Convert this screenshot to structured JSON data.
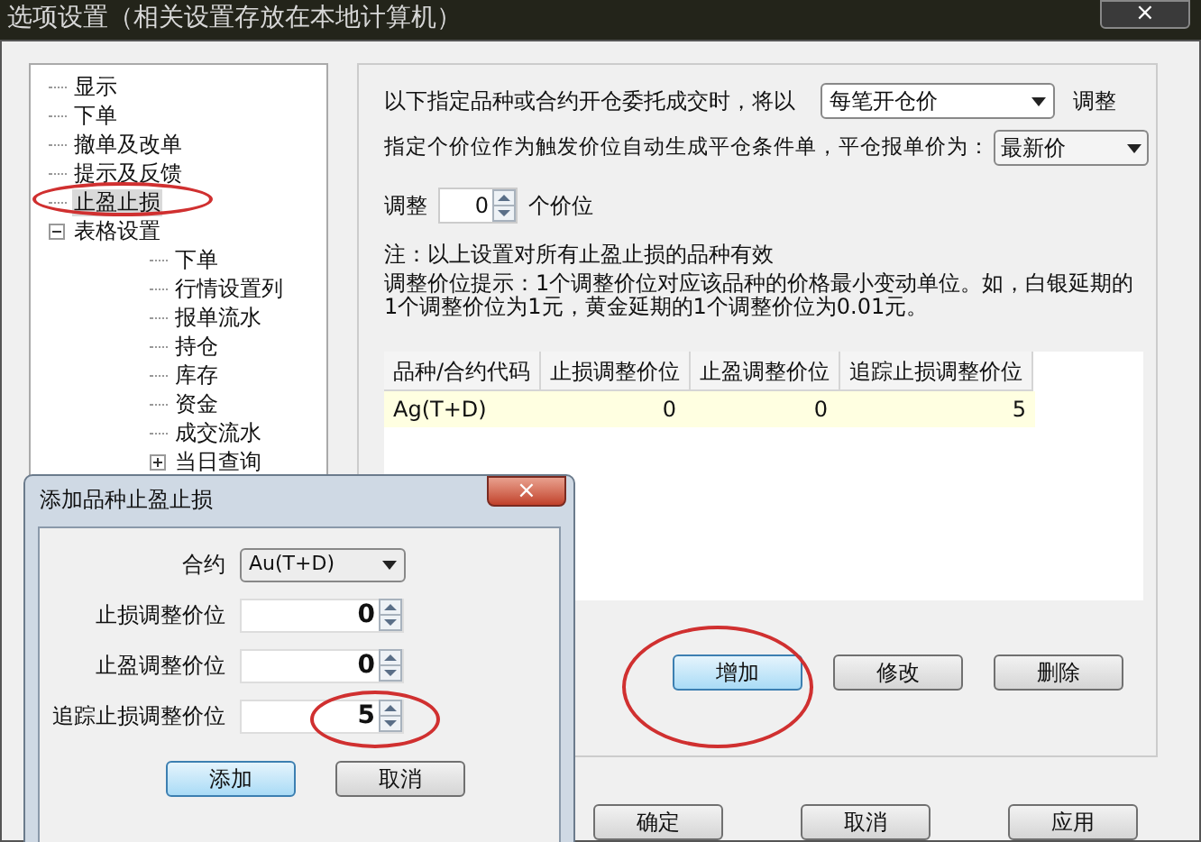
{
  "window": {
    "title": "选项设置（相关设置存放在本地计算机）",
    "close": "×"
  },
  "tree": [
    {
      "label": "显示",
      "selected": false
    },
    {
      "label": "下单",
      "selected": false
    },
    {
      "label": "撤单及改单",
      "selected": false
    },
    {
      "label": "提示及反馈",
      "selected": false
    },
    {
      "label": "止盈止损",
      "selected": true
    },
    {
      "label": "表格设置",
      "selected": false,
      "expanded": true,
      "children": [
        {
          "label": "下单",
          "selected": false
        },
        {
          "label": "行情设置列",
          "selected": false
        },
        {
          "label": "报单流水",
          "selected": false
        },
        {
          "label": "持仓",
          "selected": false
        },
        {
          "label": "库存",
          "selected": false
        },
        {
          "label": "资金",
          "selected": false
        },
        {
          "label": "成交流水",
          "selected": false
        },
        {
          "label": "当日查询",
          "selected": false,
          "expanded": false
        }
      ]
    }
  ],
  "settings": {
    "line1": "以下指定品种或合约开仓委托成交时，将以",
    "price_select": "每笔开仓价",
    "line1_end": "调整",
    "line2": "指定个价位作为触发价位自动生成平仓条件单，平仓报单价为：",
    "order_select": "最新价",
    "adjust_label": "调整",
    "adjust_value": "0",
    "adjust_unit": "个价位",
    "note": "注：以上设置对所有止盈止损的品种有效",
    "hint": "调整价位提示：1个调整价位对应该品种的价格最小变动单位。如，白银延期的1个调整价位为1元，黄金延期的1个调整价位为0.01元。"
  },
  "table": {
    "columns": [
      "品种/合约代码",
      "止损调整价位",
      "止盈调整价位",
      "追踪止损调整价位"
    ],
    "rows": [
      {
        "cells": [
          "Ag(T+D)",
          "0",
          "0",
          "5"
        ],
        "selected": true
      }
    ]
  },
  "list_buttons": [
    "增加",
    "修改",
    "删除"
  ],
  "dialog_buttons": [
    "确定",
    "取消",
    "应用"
  ],
  "add_dialog": {
    "title": "添加品种止盈止损",
    "close": "×",
    "contract_label": "合约",
    "contract": "Au(T+D)",
    "fields": [
      {
        "label": "止损调整价位",
        "value": "0"
      },
      {
        "label": "止盈调整价位",
        "value": "0"
      },
      {
        "label": "追踪止损调整价位",
        "value": "5"
      }
    ],
    "buttons": [
      {
        "label": "添加",
        "selected": true
      },
      {
        "label": "取消",
        "selected": false
      }
    ]
  }
}
